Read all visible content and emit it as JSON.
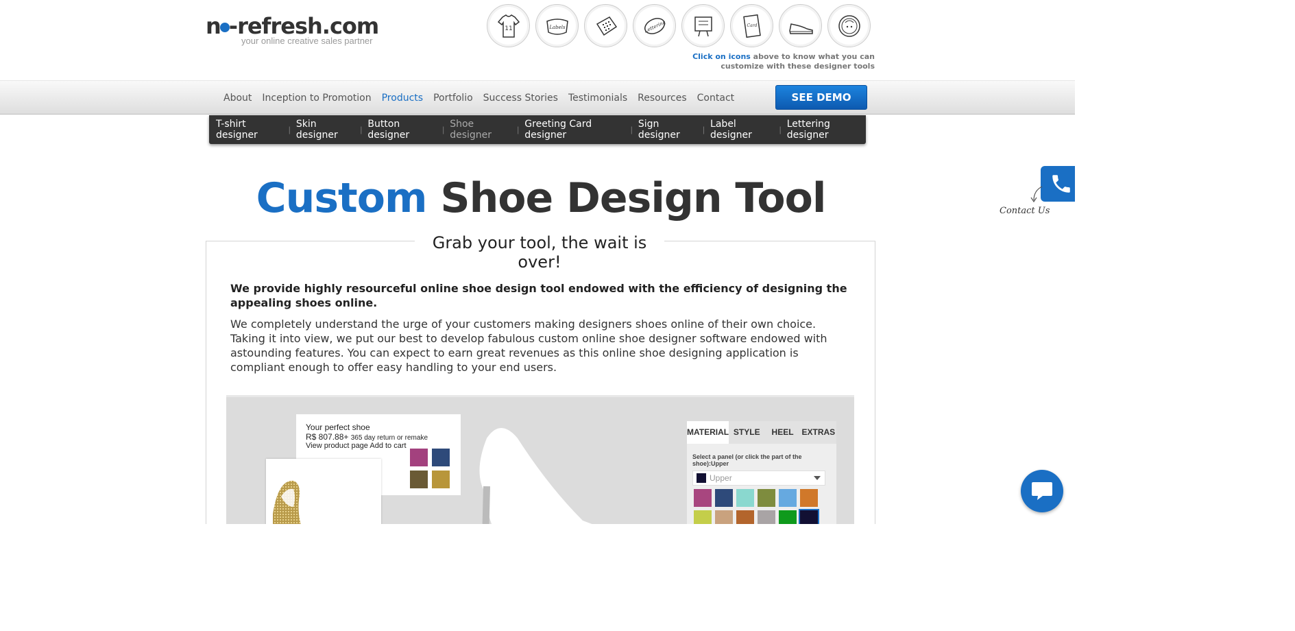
{
  "header": {
    "logo_text": "no-refresh.com",
    "logo_tagline": "your online creative sales partner",
    "icons": [
      "tshirt-icon",
      "label-icon",
      "keyboard-skin-icon",
      "lettering-icon",
      "sign-icon",
      "greeting-card-icon",
      "shoe-icon",
      "button-icon"
    ],
    "hint_highlight": "Click on icons",
    "hint_rest": "above to know what you can customize with these designer tools"
  },
  "nav": {
    "items": [
      "About",
      "Inception to Promotion",
      "Products",
      "Portfolio",
      "Success Stories",
      "Testimonials",
      "Resources",
      "Contact"
    ],
    "active": "Products",
    "demo_label": "SEE DEMO"
  },
  "subnav": {
    "items": [
      "T-shirt designer",
      "Skin designer",
      "Button designer",
      "Shoe designer",
      "Greeting Card designer",
      "Sign designer",
      "Label designer",
      "Lettering designer"
    ],
    "current": "Shoe designer"
  },
  "page": {
    "title_highlight": "Custom",
    "title_rest": "Shoe Design Tool",
    "box_title": "Grab your tool, the wait is over!",
    "lead": "We provide highly resourceful online shoe design tool endowed with the efficiency of designing the appealing shoes online.",
    "paragraph": "We completely understand the urge of your customers making designers shoes online of their own choice. Taking it into view, we put our best to develop fabulous custom online shoe designer software endowed with astounding features. You can expect to earn great revenues as this online shoe designing application is compliant enough to offer easy handling to your end users."
  },
  "app": {
    "card_title": "Your perfect shoe",
    "price": "R$ 807.88+",
    "return_text": "365 day return or remake",
    "links": "View product page Add to cart",
    "card_swatches": [
      "#a3417e",
      "#2e4a7a",
      "#6a5a35",
      "#b8963a"
    ],
    "tabs": [
      "MATERIAL",
      "STYLE",
      "HEEL",
      "EXTRAS"
    ],
    "active_tab": "MATERIAL",
    "panel_label": "Select a panel (or click the part of the shoe):Upper",
    "select_value": "Upper",
    "palette": [
      "#a8467f",
      "#2e4a7a",
      "#8ad8cf",
      "#7e8c3e",
      "#66a9e0",
      "#d0782a",
      "#c4ce4a",
      "#c9a27e",
      "#b3652c",
      "#a9a4a5",
      "#0f9a1c",
      "#121033"
    ],
    "selected_index": 11
  },
  "floating": {
    "contact_label": "Contact Us"
  }
}
